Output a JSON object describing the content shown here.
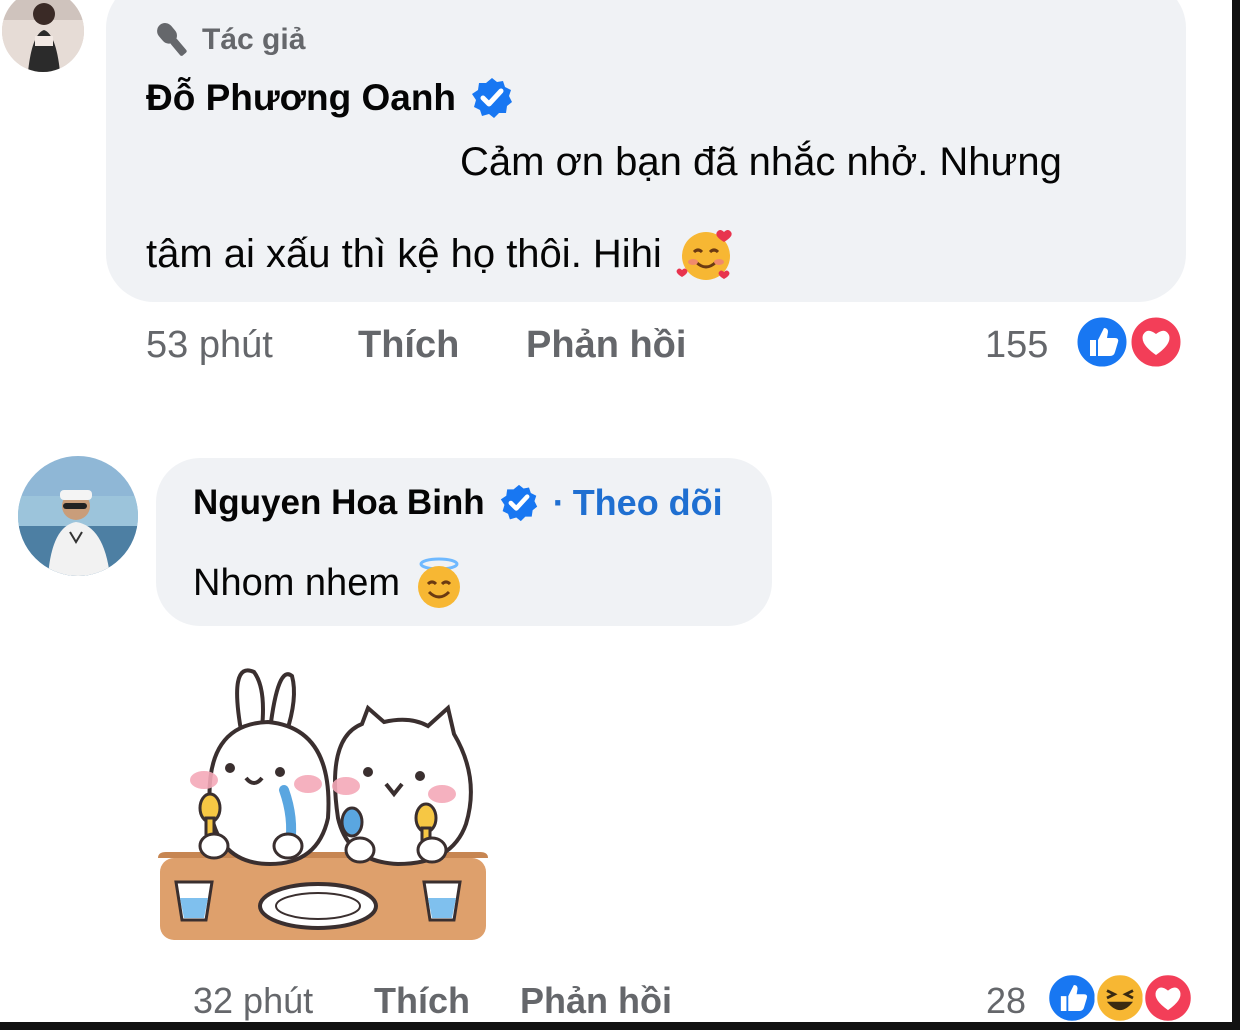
{
  "comment1": {
    "author_tag": "Tác giả",
    "name": "Đỗ Phương Oanh",
    "text_line1": "Cảm ơn bạn đã nhắc nhở. Nhưng",
    "text_line2": "tâm ai xấu thì kệ họ thôi. Hihi",
    "time": "53 phút",
    "like": "Thích",
    "reply": "Phản hồi",
    "reaction_count": "155",
    "reactions": [
      "like-icon",
      "heart-icon"
    ],
    "emoji": "smiling-face-with-hearts"
  },
  "comment2": {
    "name": "Nguyen Hoa Binh",
    "separator": "·",
    "follow": "Theo dõi",
    "text": "Nhom nhem",
    "emoji": "smiling-face-with-halo",
    "sticker": "bunny-and-cat-eating-sticker",
    "time": "32 phút",
    "like": "Thích",
    "reply": "Phản hồi",
    "reaction_count": "28",
    "reactions": [
      "like-icon",
      "haha-icon",
      "heart-icon"
    ]
  },
  "colors": {
    "bubble": "#f0f2f5",
    "meta_text": "#65676b",
    "link_blue": "#1f6fd1",
    "verified_blue": "#1877f2",
    "like_blue": "#1877f2",
    "heart_red": "#f33e58"
  }
}
